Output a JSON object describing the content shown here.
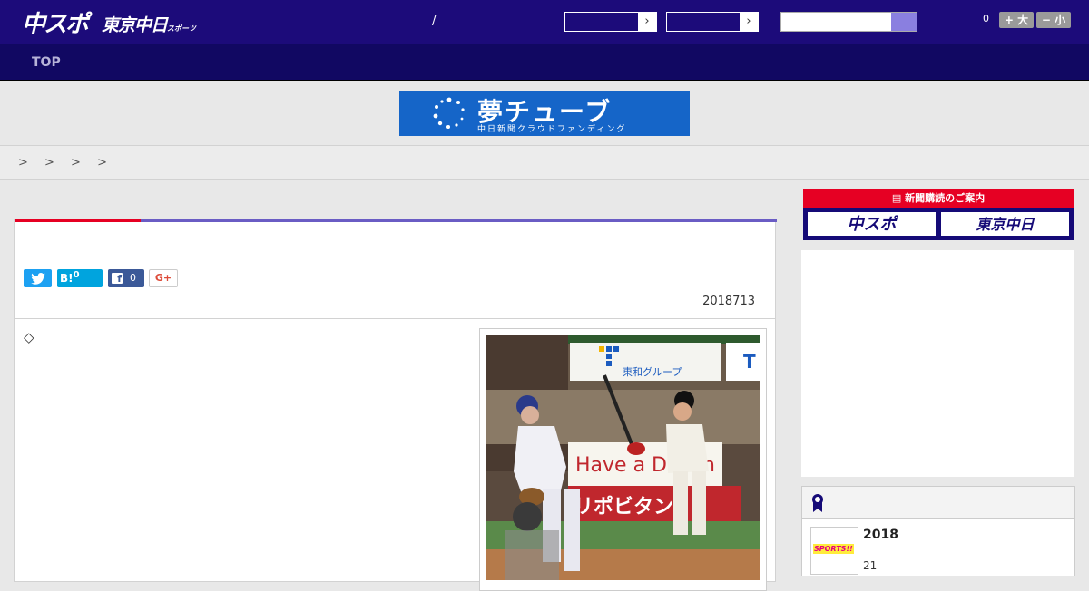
{
  "header": {
    "logo_main": "中スポ",
    "logo_sub": "東京中日",
    "logo_sub_small": "スポーツ",
    "divider": "/",
    "count": "0",
    "font_larger": "+ 大",
    "font_smaller": "− 小"
  },
  "nav": {
    "top_label": "TOP"
  },
  "banner": {
    "title": "夢チューブ",
    "subtitle": "中日新聞クラウドファンディング"
  },
  "breadcrumb": {
    "text": "> > > >"
  },
  "article": {
    "share": {
      "twitter": "",
      "hatena_label": "B!",
      "hatena_count": "0",
      "facebook_count": "0",
      "gplus_label": "G+"
    },
    "date": "2018713",
    "lead_symbol": "◇",
    "photo": {
      "sign_top": "東和グループ",
      "sign_ad": "Have a D",
      "sign_ad_end": "n",
      "sign_red": "リポビタン"
    }
  },
  "sidebar": {
    "subscribe_title": "新聞購読のご案内",
    "subscribe_buttons": [
      "中スポ",
      "東京中日"
    ],
    "ranking": {
      "year": "2018",
      "number": "21",
      "thumb_label": "SPORTS!!"
    }
  },
  "colors": {
    "header_bg": "#1c0b7a",
    "nav_bg": "#110862",
    "accent_red": "#e60023",
    "accent_purple": "#6a5cc4",
    "banner_bg": "#1565c8"
  }
}
